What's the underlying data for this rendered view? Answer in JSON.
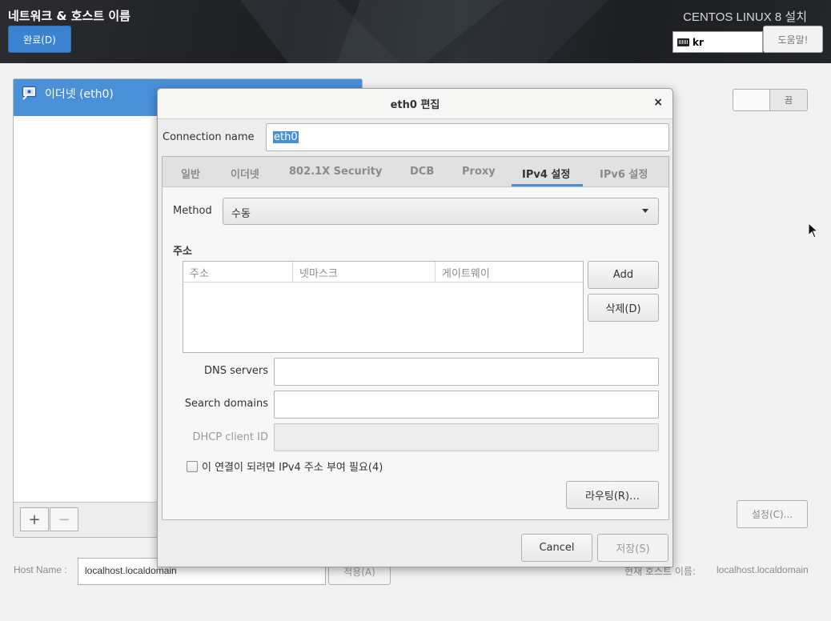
{
  "header": {
    "title": "네트워크 & 호스트 이름",
    "done_label": "완료(D)",
    "install_title": "CENTOS LINUX 8 설치",
    "keyboard_layout": "kr",
    "help_label": "도움말!"
  },
  "connections": {
    "items": [
      {
        "label": "이더넷 (eth0)",
        "icon": "ethernet-icon"
      }
    ],
    "add_label": "+",
    "remove_label": "−"
  },
  "device": {
    "toggle_label": "끔",
    "settings_label": "설정(C)..."
  },
  "hostname": {
    "label": "Host Name :",
    "value": "localhost.localdomain",
    "apply_label": "적용(A)",
    "current_label": "현재 호스트 이름:",
    "current_value": "localhost.localdomain"
  },
  "dialog": {
    "title": "eth0 편집",
    "close_label": "×",
    "connection_name_label": "Connection name",
    "connection_name_value": "eth0",
    "tabs": [
      {
        "label": "일반"
      },
      {
        "label": "이더넷"
      },
      {
        "label": "802.1X Security"
      },
      {
        "label": "DCB"
      },
      {
        "label": "Proxy"
      },
      {
        "label": "IPv4 설정",
        "active": true
      },
      {
        "label": "IPv6 설정"
      }
    ],
    "ipv4": {
      "method_label": "Method",
      "method_value": "수동",
      "addresses_heading": "주소",
      "columns": [
        "주소",
        "넷마스크",
        "게이트웨이"
      ],
      "add_label": "Add",
      "delete_label": "삭제(D)",
      "dns_label": "DNS servers",
      "dns_value": "",
      "search_label": "Search domains",
      "search_value": "",
      "dhcp_label": "DHCP client ID",
      "dhcp_value": "",
      "require_label": "이 연결이 되려면 IPv4 주소 부여 필요(4)",
      "require_checked": false,
      "routes_label": "라우팅(R)…"
    },
    "cancel_label": "Cancel",
    "save_label": "저장(S)"
  },
  "colors": {
    "accent": "#4a90d9",
    "header_bg": "#1f2124"
  }
}
